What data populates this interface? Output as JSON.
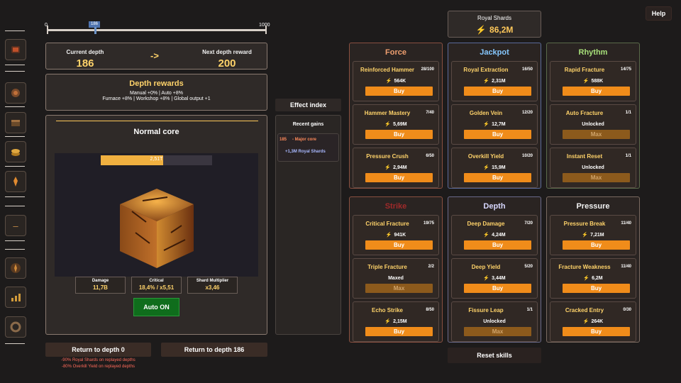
{
  "help_label": "Help",
  "royal": {
    "label": "Royal Shards",
    "value": "86,2M"
  },
  "slider": {
    "min": "0",
    "max": "1000",
    "current": "186",
    "fraction": 0.186
  },
  "depth": {
    "current_label": "Current depth",
    "current_value": "186",
    "arrow": "->",
    "next_label": "Next depth reward",
    "next_value": "200"
  },
  "rewards": {
    "title": "Depth rewards",
    "line1": "Manual +0% | Auto +8%",
    "line2": "Furnace +8% | Workshop +8% | Global output +1"
  },
  "core": {
    "title": "Normal core",
    "hp": "2,51T",
    "hp_fraction": 0.56,
    "stats": [
      {
        "label": "Damage",
        "value": "11,7B"
      },
      {
        "label": "Critical",
        "value": "18,4% / x5,51"
      },
      {
        "label": "Shard Multiplier",
        "value": "x3,46"
      }
    ],
    "auto_label": "Auto ON"
  },
  "return0": {
    "label": "Return to depth 0"
  },
  "return186": {
    "label": "Return to depth 186"
  },
  "return_notes": {
    "line1": "-90% Royal Shards on replayed depths",
    "line2": "-80% Overkill Yield on replayed depths"
  },
  "effect_index": {
    "title": "Effect index",
    "recent_title": "Recent gains",
    "gain1_depth": "185",
    "gain1_text": "- Major core",
    "gain2_text": "+1,3M Royal Shards"
  },
  "reset_label": "Reset skills",
  "columns": [
    {
      "title": "Force",
      "color": "#f0a070",
      "skills": [
        {
          "name": "Reinforced Hammer",
          "level": "28/100",
          "cost": "564K",
          "button": "Buy",
          "kind": "buy"
        },
        {
          "name": "Hammer Mastery",
          "level": "7/40",
          "cost": "5,69M",
          "button": "Buy",
          "kind": "buy"
        },
        {
          "name": "Pressure Crush",
          "level": "6/50",
          "cost": "2,94M",
          "button": "Buy",
          "kind": "buy"
        }
      ]
    },
    {
      "title": "Jackpot",
      "color": "#86c8ff",
      "skills": [
        {
          "name": "Royal Extraction",
          "level": "16/50",
          "cost": "2,31M",
          "button": "Buy",
          "kind": "buy"
        },
        {
          "name": "Golden Vein",
          "level": "12/20",
          "cost": "12,7M",
          "button": "Buy",
          "kind": "buy"
        },
        {
          "name": "Overkill Yield",
          "level": "10/20",
          "cost": "15,9M",
          "button": "Buy",
          "kind": "buy"
        }
      ]
    },
    {
      "title": "Rhythm",
      "color": "#a8e07a",
      "skills": [
        {
          "name": "Rapid Fracture",
          "level": "14/75",
          "cost": "588K",
          "button": "Buy",
          "kind": "buy"
        },
        {
          "name": "Auto Fracture",
          "level": "1/1",
          "status": "Unlocked",
          "button": "Max",
          "kind": "max"
        },
        {
          "name": "Instant Reset",
          "level": "1/1",
          "status": "Unlocked",
          "button": "Max",
          "kind": "max"
        }
      ]
    },
    {
      "title": "Strike",
      "color": "#a02a2a",
      "skills": [
        {
          "name": "Critical Fracture",
          "level": "19/75",
          "cost": "941K",
          "button": "Buy",
          "kind": "buy"
        },
        {
          "name": "Triple Fracture",
          "level": "2/2",
          "status": "Maxed",
          "button": "Max",
          "kind": "max"
        },
        {
          "name": "Echo Strike",
          "level": "8/50",
          "cost": "2,15M",
          "button": "Buy",
          "kind": "buy"
        }
      ]
    },
    {
      "title": "Depth",
      "color": "#d8d8ff",
      "skills": [
        {
          "name": "Deep Damage",
          "level": "7/20",
          "cost": "4,24M",
          "button": "Buy",
          "kind": "buy"
        },
        {
          "name": "Deep Yield",
          "level": "5/20",
          "cost": "3,44M",
          "button": "Buy",
          "kind": "buy"
        },
        {
          "name": "Fissure Leap",
          "level": "1/1",
          "status": "Unlocked",
          "button": "Max",
          "kind": "max"
        }
      ]
    },
    {
      "title": "Pressure",
      "color": "#f2f2f2",
      "skills": [
        {
          "name": "Pressure Break",
          "level": "11/40",
          "cost": "7,21M",
          "button": "Buy",
          "kind": "buy"
        },
        {
          "name": "Fracture Weakness",
          "level": "11/40",
          "cost": "6,2M",
          "button": "Buy",
          "kind": "buy"
        },
        {
          "name": "Cracked Entry",
          "level": "0/30",
          "cost": "264K",
          "button": "Buy",
          "kind": "buy"
        }
      ]
    }
  ],
  "icons": [
    "anvil-icon",
    "gear-icon",
    "chest-icon",
    "coins-icon",
    "figure-icon",
    "dash-icon",
    "helmet-icon",
    "chart-icon",
    "cog-icon"
  ]
}
